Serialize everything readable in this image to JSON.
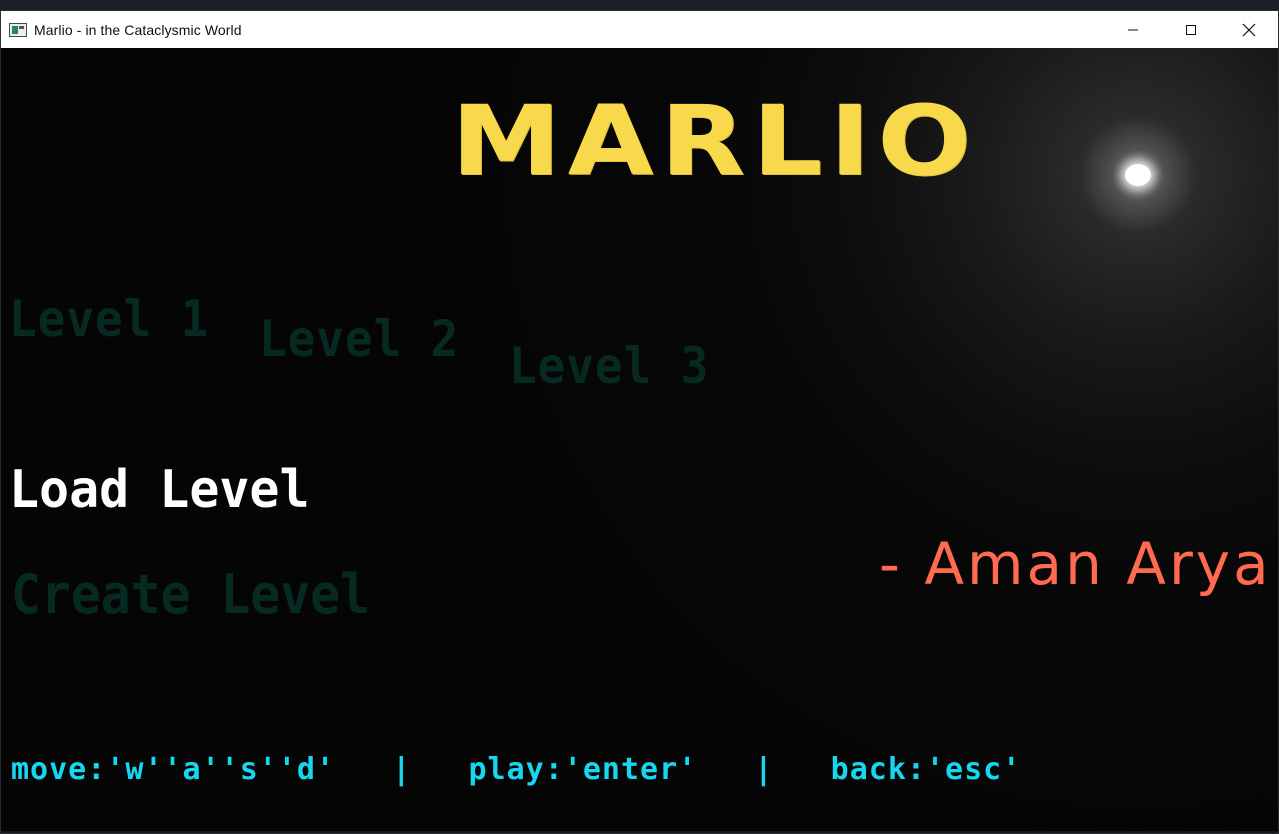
{
  "window": {
    "title": "Marlio - in the Cataclysmic World",
    "icon": "app-window-icon",
    "controls": {
      "minimize": "minimize-icon",
      "maximize": "maximize-icon",
      "close": "close-icon"
    }
  },
  "game": {
    "logo": "MARLIO",
    "levels": [
      {
        "label": "Level 1"
      },
      {
        "label": "Level 2"
      },
      {
        "label": "Level 3"
      }
    ],
    "menu": {
      "load_level": "Load Level",
      "create_level": "Create Level"
    },
    "author": "- Aman Arya",
    "controls_hint": "move:'w''a''s''d'   |   play:'enter'   |   back:'esc'"
  },
  "colors": {
    "logo": "#f9d94c",
    "author": "#ff6a50",
    "controls": "#15d7f0",
    "selected_menu": "#ffffff",
    "inactive_menu": "#062a22",
    "background": "#050505"
  }
}
